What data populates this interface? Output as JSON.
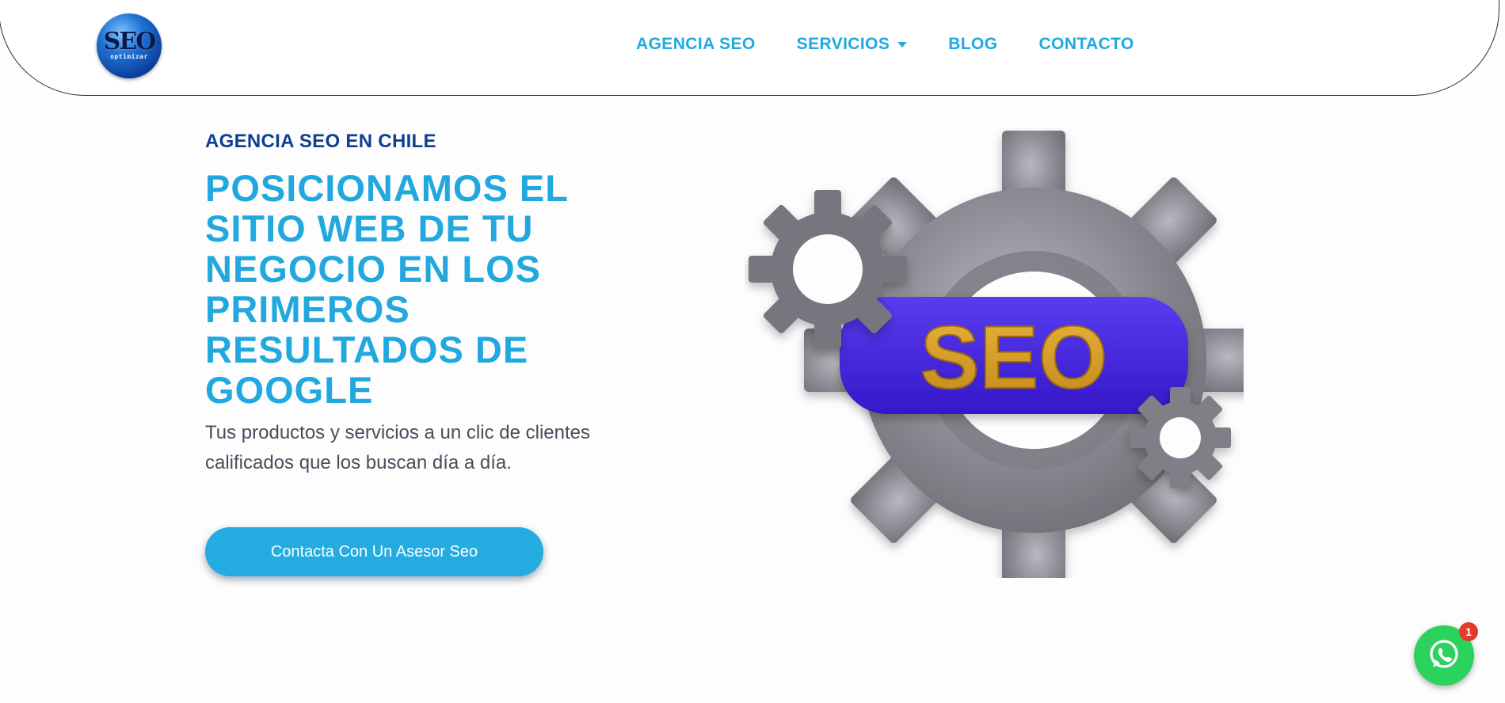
{
  "header": {
    "logo": {
      "main_text": "SEO",
      "sub_text": "optimizar"
    },
    "nav": {
      "items": [
        {
          "label": "AGENCIA SEO",
          "has_dropdown": false
        },
        {
          "label": "SERVICIOS",
          "has_dropdown": true
        },
        {
          "label": "BLOG",
          "has_dropdown": false
        },
        {
          "label": "CONTACTO",
          "has_dropdown": false
        }
      ]
    }
  },
  "hero": {
    "eyebrow": "AGENCIA SEO EN CHILE",
    "headline": "POSICIONAMOS EL SITIO WEB DE TU NEGOCIO EN LOS PRIMEROS RESULTADOS DE GOOGLE",
    "subtext": "Tus productos y servicios a un clic de clientes calificados que los buscan día a día.",
    "cta_label": "Contacta Con Un Asesor Seo",
    "illustration": {
      "icon": "gear-seo-illustration",
      "text": "SEO"
    }
  },
  "whatsapp": {
    "icon": "whatsapp-icon",
    "badge_count": "1"
  },
  "colors": {
    "accent": "#21a8df",
    "eyebrow": "#0e3f91",
    "body_text": "#4b4b5c",
    "cta_background": "#24ace1",
    "gear": "#8e8d95",
    "seo_pill": "#4328df",
    "seo_letters": "#d6a226",
    "whatsapp": "#2bd25e",
    "badge": "#e23a2b"
  }
}
